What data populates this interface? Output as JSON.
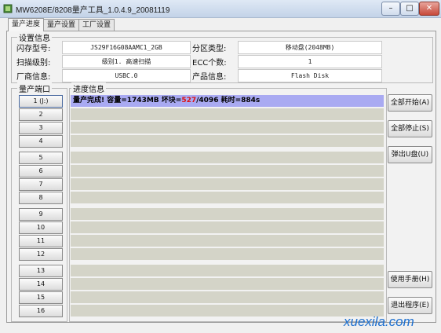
{
  "window": {
    "title": "MW6208E/8208量产工具_1.0.4.9_20081119",
    "buttons": {
      "minimize": "–",
      "maximize": "□",
      "close": "✕"
    }
  },
  "tabs": [
    "量产进度",
    "量产设置",
    "工厂设置"
  ],
  "settings": {
    "group_title": "设置信息",
    "flash_model_label": "闪存型号:",
    "flash_model_value": "JS29F16G08AAMC1_2GB",
    "partition_label": "分区类型:",
    "partition_value": "移动盘(2048MB)",
    "scan_level_label": "扫描级别:",
    "scan_level_value": "级别1. 高速扫描",
    "ecc_label": "ECC个数:",
    "ecc_value": "1",
    "vendor_label": "厂商信息:",
    "vendor_value": "USBC.0",
    "product_label": "产品信息:",
    "product_value": "Flash Disk"
  },
  "ports": {
    "title": "量产端口",
    "items": [
      "1 (J:)",
      "2",
      "3",
      "4",
      "5",
      "6",
      "7",
      "8",
      "9",
      "10",
      "11",
      "12",
      "13",
      "14",
      "15",
      "16"
    ]
  },
  "progress": {
    "title": "进度信息",
    "row1_prefix": "量产完成! 容量=1743MB 坏块=",
    "row1_bad": "527",
    "row1_suffix": "/4096 耗时=884s"
  },
  "side_buttons": {
    "start_all": "全部开始(A)",
    "stop_all": "全部停止(S)",
    "eject": "弹出U盘(U)",
    "manual": "使用手册(H)",
    "exit": "退出程序(E)"
  },
  "watermark": "xuexila.com",
  "colors": {
    "progress_done": "#a9aaf2",
    "progress_idle": "#d4d4c8",
    "bad_block": "#dd1111",
    "watermark": "#1c6fd0"
  }
}
